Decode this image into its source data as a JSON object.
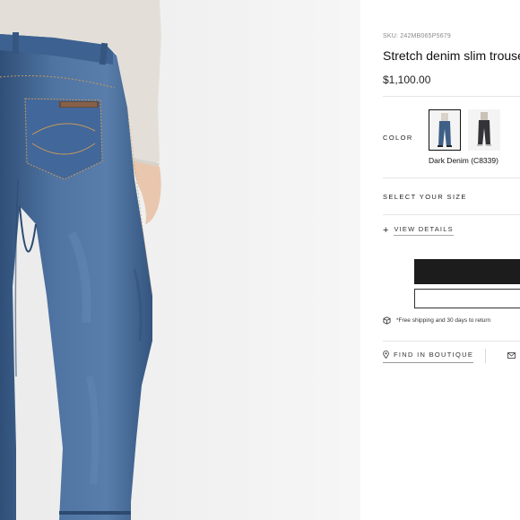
{
  "product": {
    "sku": "SKU: 242MB065P5679",
    "title": "Stretch denim slim trouse",
    "price": "$1,100.00"
  },
  "color": {
    "label": "COLOR",
    "selected_name": "Dark Denim (C8339)",
    "swatches": [
      {
        "icon": "jeans-thumbnail-dark-denim",
        "selected": true,
        "tone": "#3f5f86"
      },
      {
        "icon": "jeans-thumbnail-black",
        "selected": false,
        "tone": "#333338"
      }
    ]
  },
  "size": {
    "label": "SELECT YOUR SIZE"
  },
  "details": {
    "icon": "plus-icon",
    "label": "VIEW DETAILS"
  },
  "shipping": {
    "icon": "box-icon",
    "text": "*Free shipping and 30 days to return"
  },
  "boutique": {
    "icon": "location-pin-icon",
    "label": "FIND IN BOUTIQUE"
  },
  "contact": {
    "icon": "envelope-icon"
  },
  "colors": {
    "photo_background": "#f2f2f2",
    "denim": "#4a6d98",
    "sweater": "#e3dfd8",
    "primary_button": "#1c1c1c"
  }
}
